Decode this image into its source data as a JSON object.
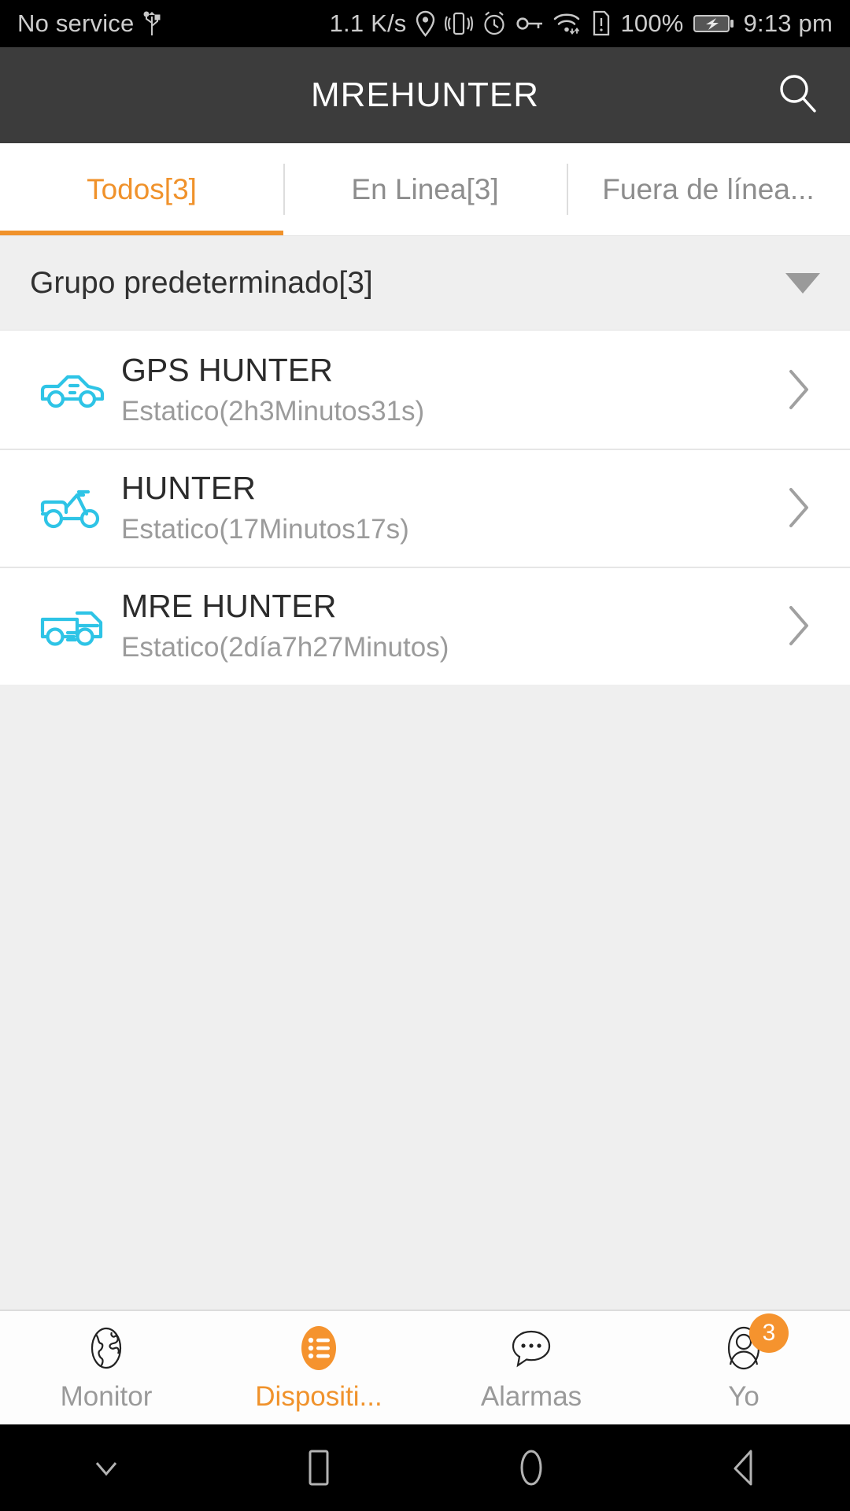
{
  "statusbar": {
    "carrier": "No service",
    "usb_icon": "usb-icon",
    "net_speed": "1.1 K/s",
    "icons": [
      "location-icon",
      "vibrate-icon",
      "alarm-icon",
      "vpn-key-icon",
      "wifi-icon",
      "sim-alert-icon"
    ],
    "battery_percent": "100%",
    "battery_icon": "battery-charging-icon",
    "time": "9:13 pm"
  },
  "titlebar": {
    "title": "MREHUNTER",
    "search_icon": "search-icon"
  },
  "tabs": [
    {
      "label": "Todos[3]",
      "active": true
    },
    {
      "label": "En Linea[3]",
      "active": false
    },
    {
      "label": "Fuera de línea...",
      "active": false
    }
  ],
  "group": {
    "title": "Grupo predeterminado[3]",
    "caret_icon": "chevron-down-icon"
  },
  "devices": [
    {
      "name": "GPS HUNTER",
      "status": "Estatico(2h3Minutos31s)",
      "icon": "car-icon"
    },
    {
      "name": "HUNTER",
      "status": "Estatico(17Minutos17s)",
      "icon": "motorcycle-icon"
    },
    {
      "name": "MRE HUNTER",
      "status": "Estatico(2día7h27Minutos)",
      "icon": "truck-icon"
    }
  ],
  "bottomnav": [
    {
      "label": "Monitor",
      "icon": "globe-icon",
      "active": false,
      "badge": ""
    },
    {
      "label": "Dispositi...",
      "icon": "device-list-icon",
      "active": true,
      "badge": ""
    },
    {
      "label": "Alarmas",
      "icon": "chat-bubble-icon",
      "active": false,
      "badge": ""
    },
    {
      "label": "Yo",
      "icon": "person-icon",
      "active": false,
      "badge": "3"
    }
  ],
  "androidnav": [
    {
      "icon": "hide-navbar-icon"
    },
    {
      "icon": "recents-square-icon"
    },
    {
      "icon": "home-circle-icon"
    },
    {
      "icon": "back-triangle-icon"
    }
  ],
  "colors": {
    "accent": "#f0922b",
    "vehicle_icon": "#2ec4e6",
    "titlebar_bg": "#3c3c3c",
    "group_bg": "#efefef"
  }
}
